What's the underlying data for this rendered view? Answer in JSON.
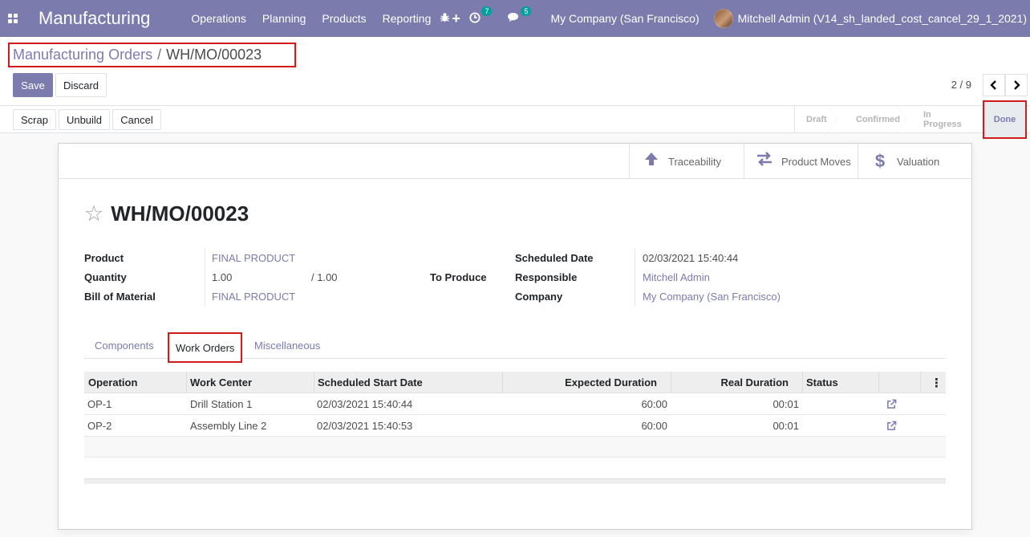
{
  "navbar": {
    "app_name": "Manufacturing",
    "menu": [
      "Operations",
      "Planning",
      "Products",
      "Reporting"
    ],
    "add_icon": "+",
    "activity_count": "7",
    "message_count": "5",
    "company": "My Company (San Francisco)",
    "user": "Mitchell Admin (V14_sh_landed_cost_cancel_29_1_2021)"
  },
  "breadcrumb": {
    "parent": "Manufacturing Orders",
    "separator": "/",
    "current": "WH/MO/00023"
  },
  "actions": {
    "save": "Save",
    "discard": "Discard"
  },
  "pager": {
    "value": "2 / 9"
  },
  "header_buttons": {
    "scrap": "Scrap",
    "unbuild": "Unbuild",
    "cancel": "Cancel"
  },
  "stages": [
    "Draft",
    "Confirmed",
    "In Progress",
    "Done"
  ],
  "current_stage": "Done",
  "smart_buttons": {
    "traceability": "Traceability",
    "product_moves": "Product Moves",
    "valuation": "Valuation"
  },
  "form": {
    "name": "WH/MO/00023",
    "product_label": "Product",
    "product": "FINAL PRODUCT",
    "quantity_label": "Quantity",
    "quantity": "1.00",
    "quantity_total": "/ 1.00",
    "to_produce": "To Produce",
    "bom_label": "Bill of Material",
    "bom": "FINAL PRODUCT",
    "scheduled_date_label": "Scheduled Date",
    "scheduled_date": "02/03/2021 15:40:44",
    "responsible_label": "Responsible",
    "responsible": "Mitchell Admin",
    "company_label": "Company",
    "company": "My Company (San Francisco)"
  },
  "tabs": [
    "Components",
    "Work Orders",
    "Miscellaneous"
  ],
  "active_tab": "Work Orders",
  "work_orders": {
    "columns": [
      "Operation",
      "Work Center",
      "Scheduled Start Date",
      "Expected Duration",
      "Real Duration",
      "Status"
    ],
    "rows": [
      {
        "operation": "OP-1",
        "work_center": "Drill Station 1",
        "start": "02/03/2021 15:40:44",
        "expected": "60:00",
        "real": "00:01",
        "status": ""
      },
      {
        "operation": "OP-2",
        "work_center": "Assembly Line 2",
        "start": "02/03/2021 15:40:53",
        "expected": "60:00",
        "real": "00:01",
        "status": ""
      }
    ]
  }
}
